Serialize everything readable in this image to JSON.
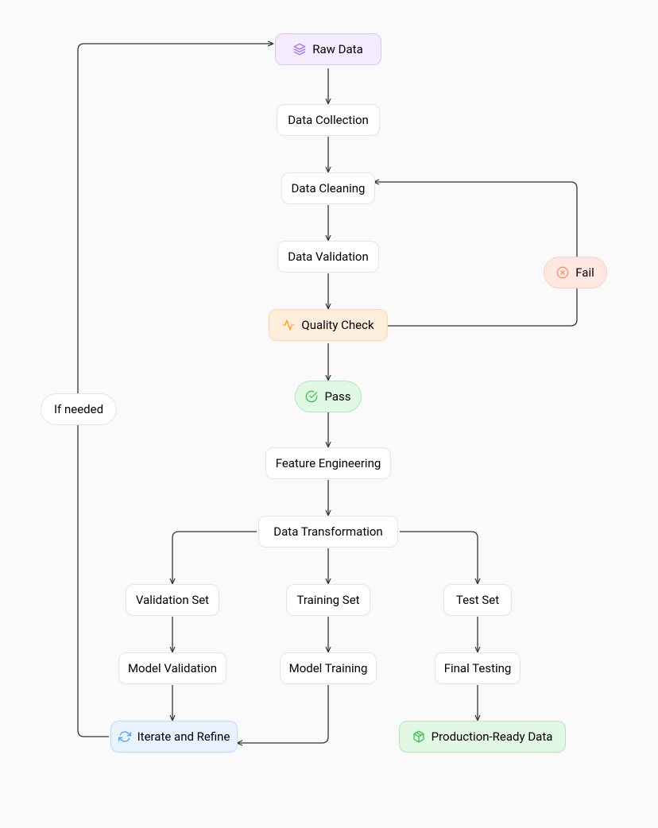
{
  "nodes": {
    "raw_data": "Raw Data",
    "data_collection": "Data Collection",
    "data_cleaning": "Data Cleaning",
    "data_validation": "Data Validation",
    "quality_check": "Quality Check",
    "pass": "Pass",
    "fail": "Fail",
    "feature_engineering": "Feature Engineering",
    "data_transformation": "Data Transformation",
    "validation_set": "Validation Set",
    "training_set": "Training Set",
    "test_set": "Test Set",
    "model_validation": "Model Validation",
    "model_training": "Model Training",
    "final_testing": "Final Testing",
    "iterate_refine": "Iterate and Refine",
    "production_ready": "Production-Ready Data",
    "if_needed": "If needed"
  },
  "colors": {
    "purple_icon": "#9d6fff",
    "orange_icon": "#ff9f2e",
    "green_icon": "#3fbf58",
    "blue_icon": "#4da3ff",
    "peach_icon": "#ff8f6b",
    "arrow": "#333333"
  }
}
